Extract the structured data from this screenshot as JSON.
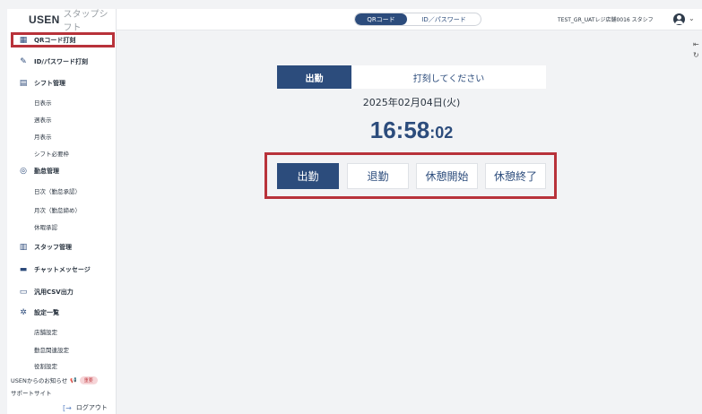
{
  "brand": {
    "name": "USEN",
    "sub": "スタップシフト"
  },
  "sidebar": {
    "items": [
      {
        "icon": "qr-code-icon",
        "glyph": "▦",
        "label": "QRコード打刻"
      },
      {
        "icon": "user-edit-icon",
        "glyph": "✎",
        "label": "ID/パスワード打刻"
      },
      {
        "icon": "calendar-icon",
        "glyph": "▤",
        "label": "シフト管理"
      },
      {
        "label": "日表示"
      },
      {
        "label": "週表示"
      },
      {
        "label": "月表示"
      },
      {
        "label": "シフト必要枠"
      },
      {
        "icon": "check-circle-icon",
        "glyph": "◎",
        "label": "勤怠管理"
      },
      {
        "label": "日次（勤怠承認）"
      },
      {
        "label": "月次（勤怠締め）"
      },
      {
        "label": "休暇承認"
      },
      {
        "icon": "staff-icon",
        "glyph": "▥",
        "label": "スタッフ管理"
      },
      {
        "icon": "chat-icon",
        "glyph": "▬",
        "label": "チャットメッセージ"
      },
      {
        "icon": "csv-icon",
        "glyph": "▭",
        "label": "汎用CSV出力"
      },
      {
        "icon": "gear-icon",
        "glyph": "✲",
        "label": "設定一覧"
      },
      {
        "label": "店舗設定"
      },
      {
        "label": "勤怠関連設定"
      },
      {
        "label": "役割設定"
      }
    ],
    "news_label": "USENからのお知らせ",
    "news_badge": "重要",
    "support_label": "サポートサイト",
    "logout_label": "ログアウト"
  },
  "header": {
    "toggle_qr": "QRコード",
    "toggle_id": "ID／パスワード",
    "store": "TEST_GR_UATレジ店舗0016 スタシフ"
  },
  "main": {
    "tab_active": "出勤",
    "tab_message": "打刻してください",
    "date": "2025年02月04日(火)",
    "time_hm": "16:58",
    "time_sec": ":02",
    "buttons": [
      "出勤",
      "退勤",
      "休憩開始",
      "休憩終了"
    ]
  },
  "colors": {
    "accent": "#2c4c7c",
    "highlight": "#b8323a"
  }
}
